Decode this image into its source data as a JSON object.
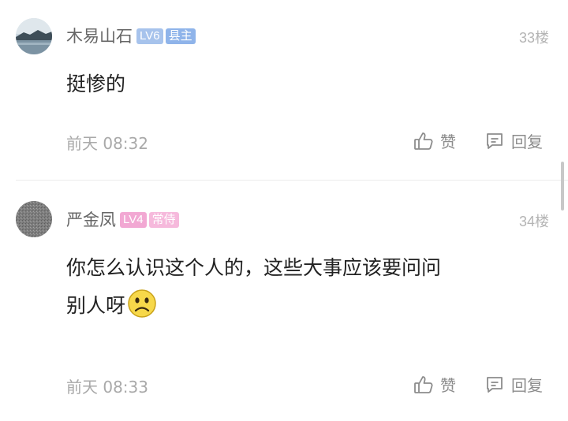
{
  "comments": [
    {
      "username": "木易山石",
      "level": "LV6",
      "title": "县主",
      "floor": "33楼",
      "text_lines": [
        "挺惨的"
      ],
      "time": "前天 08:32",
      "like_label": "赞",
      "reply_label": "回复"
    },
    {
      "username": "严金凤",
      "level": "LV4",
      "title": "常侍",
      "floor": "34楼",
      "text_lines": [
        "你怎么认识这个人的，这些大事应该要问问",
        "别人呀"
      ],
      "time": "前天 08:33",
      "like_label": "赞",
      "reply_label": "回复"
    }
  ],
  "icons": {
    "like": "thumbs-up-icon",
    "reply": "comment-bubble-icon",
    "emoji": "sad-face-emoji"
  }
}
